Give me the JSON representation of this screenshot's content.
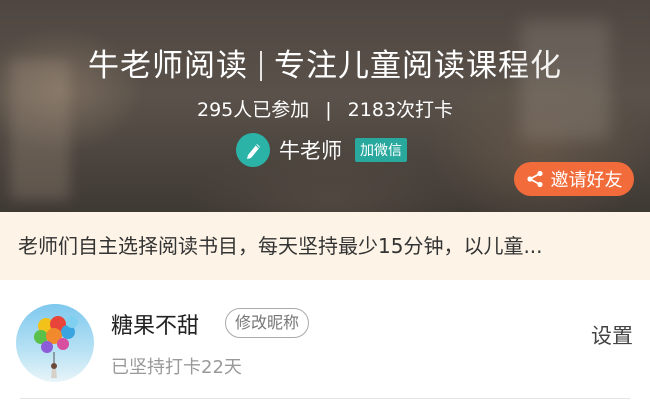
{
  "header": {
    "title_left": "牛老师阅读",
    "title_right": "专注儿童阅读课程化",
    "participants": "295人已参加",
    "divider": "|",
    "checkins": "2183次打卡",
    "teacher_name": "牛老师",
    "wechat_tag": "加微信",
    "invite_label": "邀请好友"
  },
  "notice": {
    "text": "老师们自主选择阅读书目，每天坚持最少15分钟，以儿童..."
  },
  "user": {
    "nickname": "糖果不甜",
    "edit_label": "修改昵称",
    "checkin_days": "已坚持打卡22天",
    "settings_label": "设置"
  },
  "colors": {
    "accent_orange": "#f26b3a",
    "accent_teal": "#29a89e",
    "notice_bg": "#fdf4e7"
  },
  "icons": {
    "share": "share-icon",
    "teacher_avatar": "pencil-icon"
  }
}
